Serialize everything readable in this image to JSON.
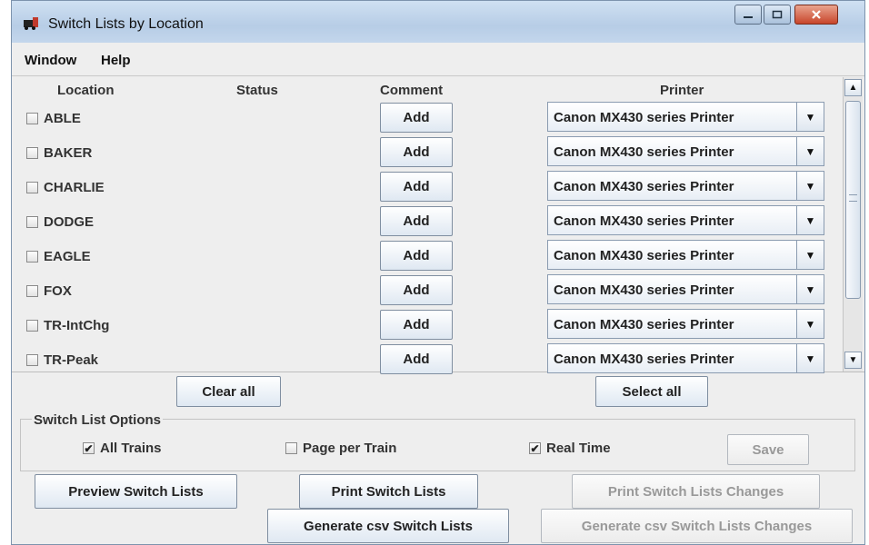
{
  "window": {
    "title": "Switch Lists by Location"
  },
  "menu": [
    "Window",
    "Help"
  ],
  "columns": {
    "location": "Location",
    "status": "Status",
    "comment": "Comment",
    "printer": "Printer"
  },
  "rows": [
    {
      "location": "ABLE",
      "comment_button": "Add",
      "printer": "Canon MX430 series Printer"
    },
    {
      "location": "BAKER",
      "comment_button": "Add",
      "printer": "Canon MX430 series Printer"
    },
    {
      "location": "CHARLIE",
      "comment_button": "Add",
      "printer": "Canon MX430 series Printer"
    },
    {
      "location": "DODGE",
      "comment_button": "Add",
      "printer": "Canon MX430 series Printer"
    },
    {
      "location": "EAGLE",
      "comment_button": "Add",
      "printer": "Canon MX430 series Printer"
    },
    {
      "location": "FOX",
      "comment_button": "Add",
      "printer": "Canon MX430 series Printer"
    },
    {
      "location": "TR-IntChg",
      "comment_button": "Add",
      "printer": "Canon MX430 series Printer"
    },
    {
      "location": "TR-Peak",
      "comment_button": "Add",
      "printer": "Canon MX430 series Printer"
    }
  ],
  "selection": {
    "clear_all": "Clear all",
    "select_all": "Select all"
  },
  "options": {
    "title": "Switch List Options",
    "all_trains": {
      "label": "All Trains",
      "checked": true,
      "mark": "✔"
    },
    "page_per_train": {
      "label": "Page per Train",
      "checked": false,
      "mark": ""
    },
    "real_time": {
      "label": "Real Time",
      "checked": true,
      "mark": "✔"
    },
    "save": "Save"
  },
  "actions": {
    "preview": "Preview Switch Lists",
    "print": "Print Switch Lists",
    "print_changes": "Print Switch Lists Changes",
    "generate_csv": "Generate csv Switch Lists",
    "generate_csv_changes": "Generate csv Switch Lists Changes"
  },
  "colors": {
    "title_bar": "#bcd1e8",
    "panel": "#eeeeee",
    "close_button": "#c8452a",
    "disabled_text": "#999999"
  }
}
